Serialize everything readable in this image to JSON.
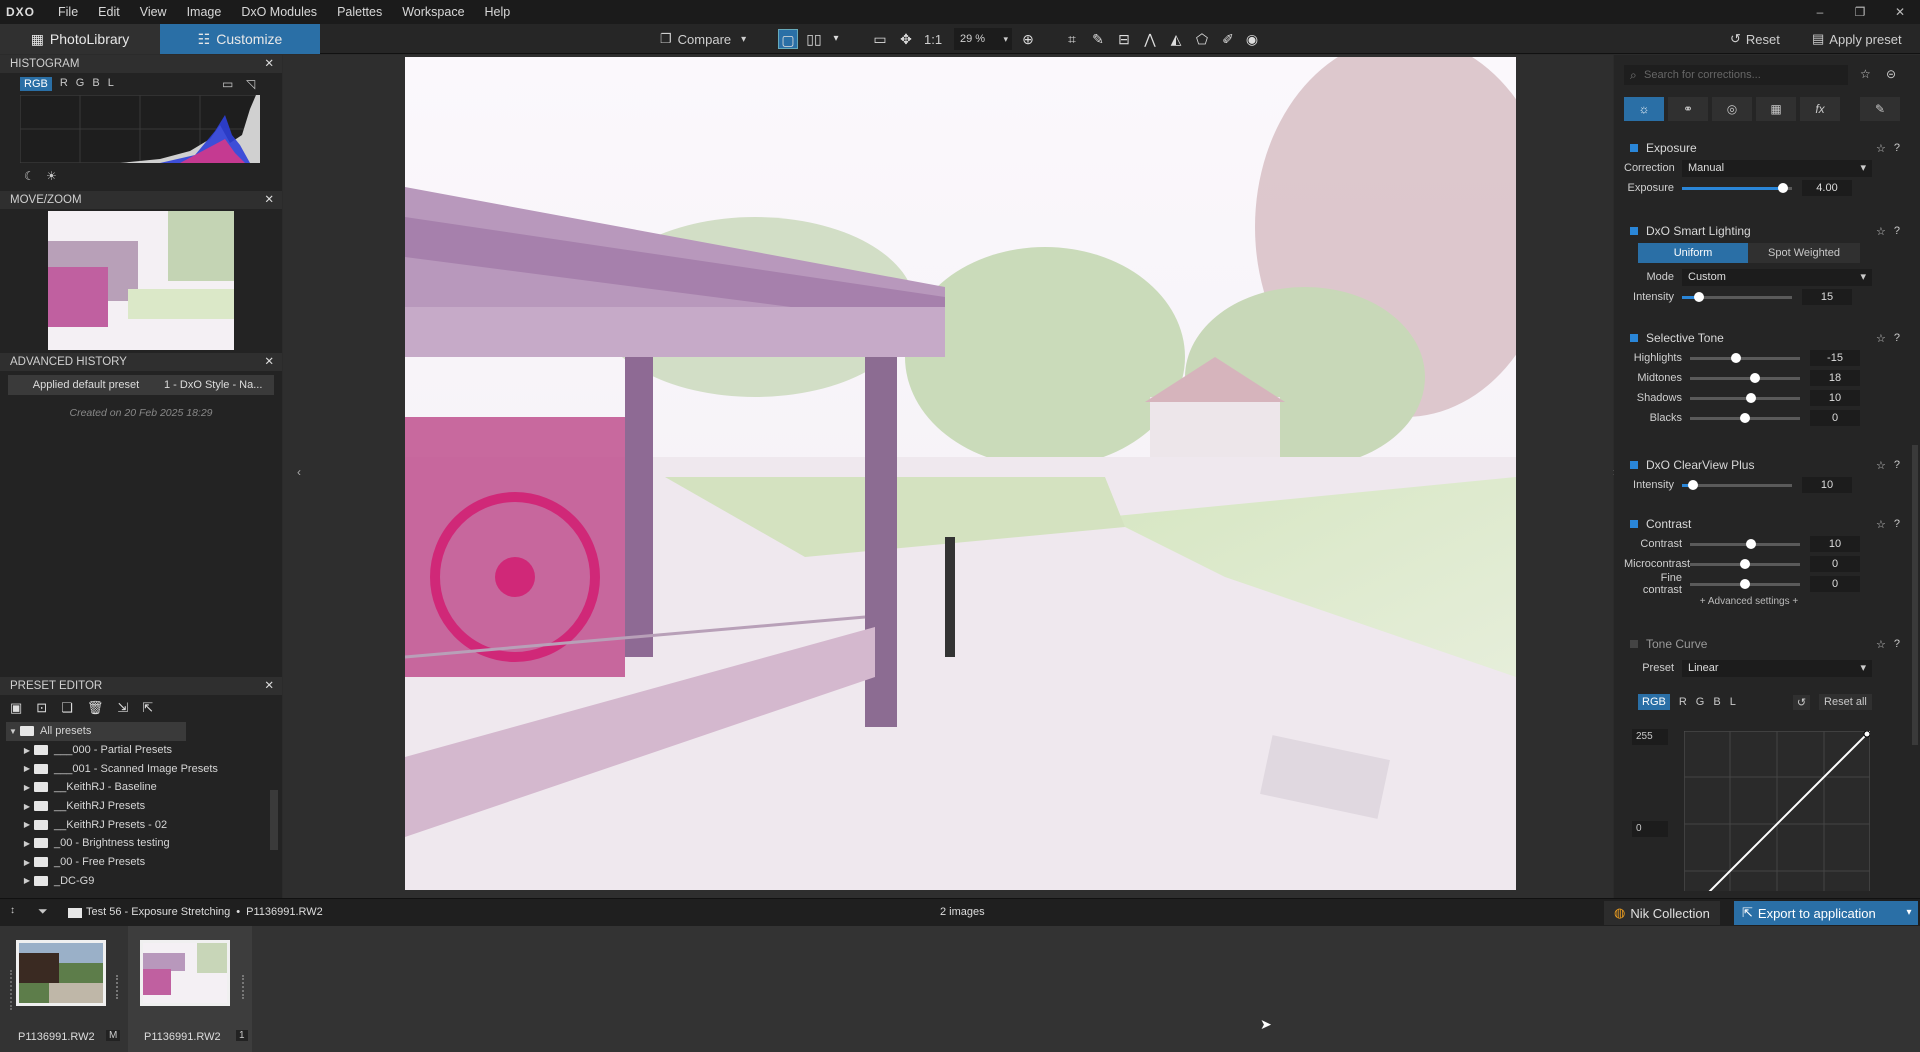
{
  "menu": {
    "logo": "DXO",
    "items": [
      "File",
      "Edit",
      "View",
      "Image",
      "DxO Modules",
      "Palettes",
      "Workspace",
      "Help"
    ]
  },
  "tabs": {
    "library": "PhotoLibrary",
    "customize": "Customize"
  },
  "toolbar": {
    "compare": "Compare",
    "one_to_one": "1:1",
    "zoom": "29 %",
    "reset": "Reset",
    "apply_preset": "Apply preset"
  },
  "histogram": {
    "title": "HISTOGRAM",
    "channels": [
      "RGB",
      "R",
      "G",
      "B",
      "L"
    ]
  },
  "movezoom": {
    "title": "MOVE/ZOOM"
  },
  "history": {
    "title": "ADVANCED HISTORY",
    "entry_left": "Applied default preset",
    "entry_right": "1 - DxO Style - Na...",
    "created": "Created on 20 Feb 2025 18:29"
  },
  "preset_editor": {
    "title": "PRESET EDITOR",
    "root": "All presets",
    "items": [
      "___000 - Partial Presets",
      "___001 - Scanned Image Presets",
      "__KeithRJ - Baseline",
      "__KeithRJ Presets",
      "__KeithRJ Presets - 02",
      "_00 - Brightness testing",
      "_00 - Free Presets",
      "_DC-G9"
    ]
  },
  "right": {
    "search_placeholder": "Search for corrections...",
    "exposure": {
      "title": "Exposure",
      "correction_label": "Correction",
      "correction": "Manual",
      "exposure_label": "Exposure",
      "exposure_value": "4.00",
      "exposure_frac": 0.92
    },
    "smart": {
      "title": "DxO Smart Lighting",
      "uniform": "Uniform",
      "spot": "Spot Weighted",
      "mode_label": "Mode",
      "mode": "Custom",
      "intensity_label": "Intensity",
      "intensity_value": "15",
      "intensity_frac": 0.15
    },
    "tone": {
      "title": "Selective Tone",
      "rows": [
        {
          "label": "Highlights",
          "value": "-15",
          "frac": 0.42
        },
        {
          "label": "Midtones",
          "value": "18",
          "frac": 0.59
        },
        {
          "label": "Shadows",
          "value": "10",
          "frac": 0.55
        },
        {
          "label": "Blacks",
          "value": "0",
          "frac": 0.5
        }
      ]
    },
    "clearview": {
      "title": "DxO ClearView Plus",
      "intensity_label": "Intensity",
      "intensity_value": "10",
      "intensity_frac": 0.1
    },
    "contrast": {
      "title": "Contrast",
      "rows": [
        {
          "label": "Contrast",
          "value": "10",
          "frac": 0.55
        },
        {
          "label": "Microcontrast",
          "value": "0",
          "frac": 0.5
        },
        {
          "label": "Fine contrast",
          "value": "0",
          "frac": 0.5
        }
      ],
      "advanced": "+ Advanced settings +"
    },
    "curve": {
      "title": "Tone Curve",
      "preset_label": "Preset",
      "preset": "Linear",
      "channels": [
        "RGB",
        "R",
        "G",
        "B",
        "L"
      ],
      "reset_all": "Reset all",
      "top_value": "255",
      "bottom_value": "0"
    }
  },
  "bottom": {
    "path": "Test 56 - Exposure Stretching",
    "file": "P1136991.RW2",
    "count": "2 images",
    "nik": "Nik Collection",
    "export": "Export to application"
  },
  "film": {
    "items": [
      {
        "name": "P1136991.RW2",
        "badge": "M"
      },
      {
        "name": "P1136991.RW2",
        "badge": "1"
      }
    ]
  }
}
